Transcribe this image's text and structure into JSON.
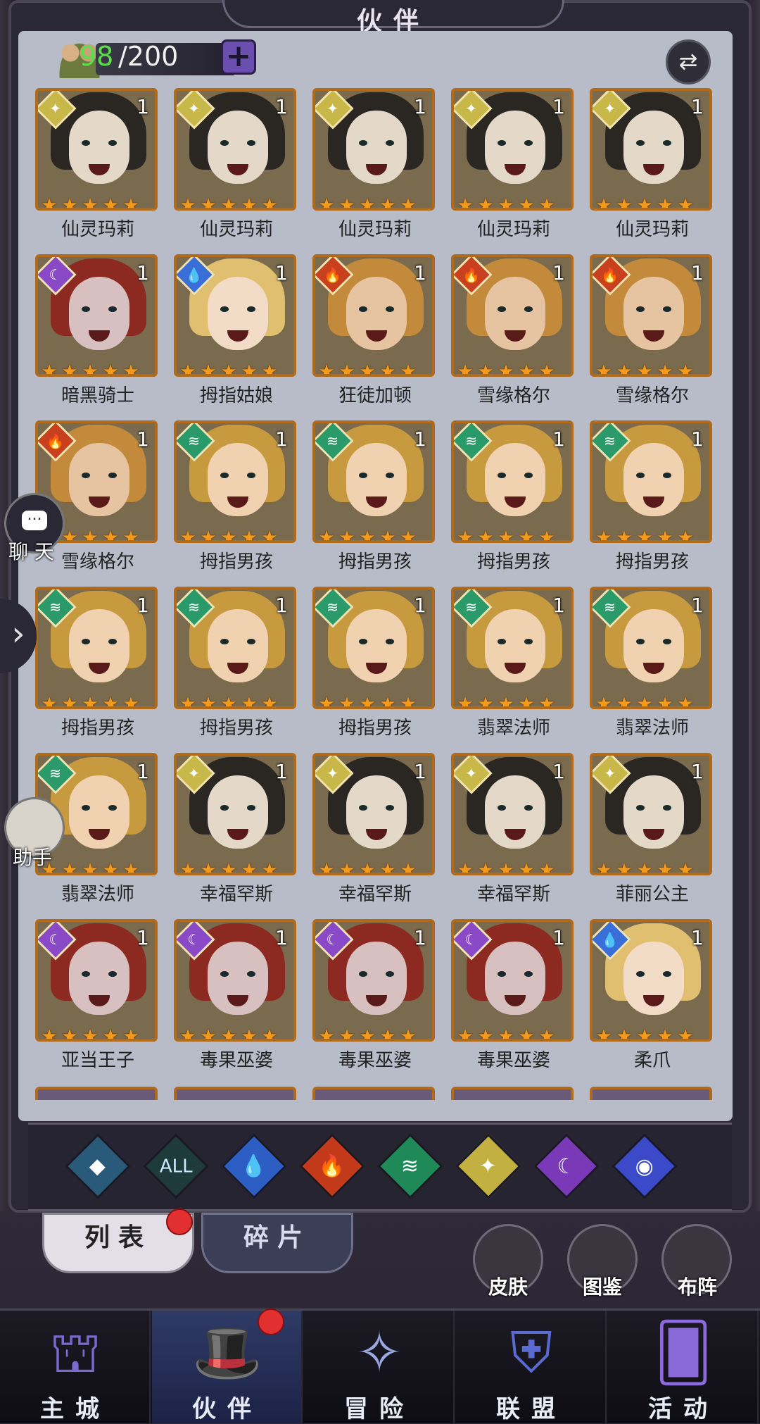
{
  "header": {
    "title": "伙伴"
  },
  "roster": {
    "current": "98",
    "max": "/200"
  },
  "colors": {
    "light": "#c8b84a",
    "dark": "#8a4ac8",
    "water": "#3a6ed8",
    "fire": "#c8401e",
    "wind": "#2a9a6a",
    "star": "#f39a1c"
  },
  "heroes": [
    {
      "name": "仙灵玛莉",
      "element": "light",
      "level": "1",
      "stars": 5
    },
    {
      "name": "仙灵玛莉",
      "element": "light",
      "level": "1",
      "stars": 5
    },
    {
      "name": "仙灵玛莉",
      "element": "light",
      "level": "1",
      "stars": 5
    },
    {
      "name": "仙灵玛莉",
      "element": "light",
      "level": "1",
      "stars": 5
    },
    {
      "name": "仙灵玛莉",
      "element": "light",
      "level": "1",
      "stars": 5
    },
    {
      "name": "暗黑骑士",
      "element": "dark",
      "level": "1",
      "stars": 5
    },
    {
      "name": "拇指姑娘",
      "element": "water",
      "level": "1",
      "stars": 5
    },
    {
      "name": "狂徒加顿",
      "element": "fire",
      "level": "1",
      "stars": 5
    },
    {
      "name": "雪缘格尔",
      "element": "fire",
      "level": "1",
      "stars": 5
    },
    {
      "name": "雪缘格尔",
      "element": "fire",
      "level": "1",
      "stars": 5
    },
    {
      "name": "雪缘格尔",
      "element": "fire",
      "level": "1",
      "stars": 5
    },
    {
      "name": "拇指男孩",
      "element": "wind",
      "level": "1",
      "stars": 5
    },
    {
      "name": "拇指男孩",
      "element": "wind",
      "level": "1",
      "stars": 5
    },
    {
      "name": "拇指男孩",
      "element": "wind",
      "level": "1",
      "stars": 5
    },
    {
      "name": "拇指男孩",
      "element": "wind",
      "level": "1",
      "stars": 5
    },
    {
      "name": "拇指男孩",
      "element": "wind",
      "level": "1",
      "stars": 5
    },
    {
      "name": "拇指男孩",
      "element": "wind",
      "level": "1",
      "stars": 5
    },
    {
      "name": "拇指男孩",
      "element": "wind",
      "level": "1",
      "stars": 5
    },
    {
      "name": "翡翠法师",
      "element": "wind",
      "level": "1",
      "stars": 5
    },
    {
      "name": "翡翠法师",
      "element": "wind",
      "level": "1",
      "stars": 5
    },
    {
      "name": "翡翠法师",
      "element": "wind",
      "level": "1",
      "stars": 5
    },
    {
      "name": "幸福罕斯",
      "element": "light",
      "level": "1",
      "stars": 5
    },
    {
      "name": "幸福罕斯",
      "element": "light",
      "level": "1",
      "stars": 5
    },
    {
      "name": "幸福罕斯",
      "element": "light",
      "level": "1",
      "stars": 5
    },
    {
      "name": "菲丽公主",
      "element": "light",
      "level": "1",
      "stars": 5
    },
    {
      "name": "亚当王子",
      "element": "dark",
      "level": "1",
      "stars": 5
    },
    {
      "name": "毒果巫婆",
      "element": "dark",
      "level": "1",
      "stars": 5
    },
    {
      "name": "毒果巫婆",
      "element": "dark",
      "level": "1",
      "stars": 5
    },
    {
      "name": "毒果巫婆",
      "element": "dark",
      "level": "1",
      "stars": 5
    },
    {
      "name": "柔爪",
      "element": "water",
      "level": "1",
      "stars": 5
    }
  ],
  "side": {
    "chat": "聊 天",
    "helper": "助手"
  },
  "filters": [
    {
      "id": "all-frame",
      "icon": "diamond-icon",
      "label": ""
    },
    {
      "id": "all",
      "icon": "all-icon",
      "label": "ALL"
    },
    {
      "id": "water",
      "icon": "water-drop-icon",
      "label": ""
    },
    {
      "id": "fire",
      "icon": "flame-icon",
      "label": ""
    },
    {
      "id": "wind",
      "icon": "whirlwind-icon",
      "label": ""
    },
    {
      "id": "light",
      "icon": "sun-star-icon",
      "label": ""
    },
    {
      "id": "dark",
      "icon": "crescent-moon-icon",
      "label": ""
    },
    {
      "id": "cosmic",
      "icon": "planet-icon",
      "label": ""
    }
  ],
  "tabs": {
    "list": "列表",
    "fragments": "碎片"
  },
  "quick": {
    "skin": "皮肤",
    "codex": "图鉴",
    "formation": "布阵"
  },
  "nav": [
    {
      "label": "主城",
      "icon": "castle-icon"
    },
    {
      "label": "伙伴",
      "icon": "witch-hat-icon"
    },
    {
      "label": "冒险",
      "icon": "compass-icon"
    },
    {
      "label": "联盟",
      "icon": "shield-icon"
    },
    {
      "label": "活动",
      "icon": "cards-icon"
    }
  ]
}
